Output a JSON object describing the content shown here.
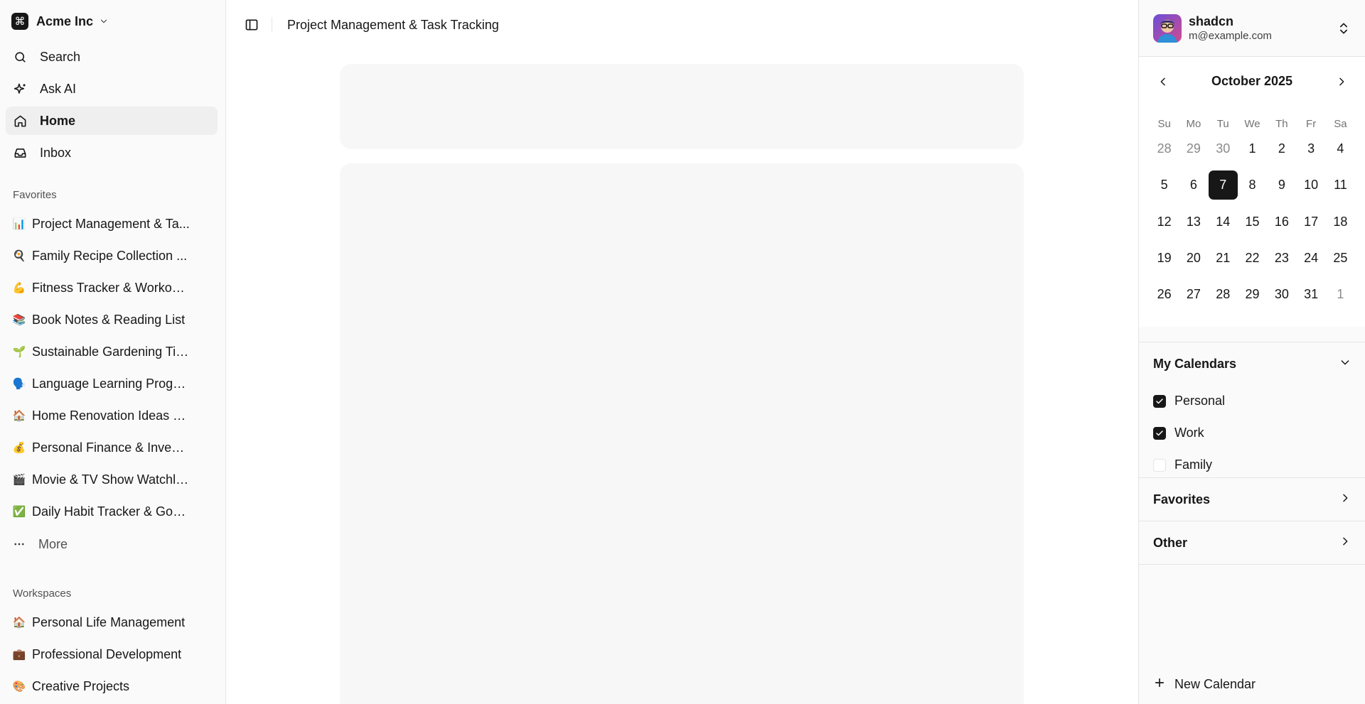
{
  "team": {
    "name": "Acme Inc",
    "logo_icon": "command-icon"
  },
  "nav": [
    {
      "label": "Search",
      "icon": "search-icon",
      "active": false
    },
    {
      "label": "Ask AI",
      "icon": "sparkles-icon",
      "active": false
    },
    {
      "label": "Home",
      "icon": "home-icon",
      "active": true
    },
    {
      "label": "Inbox",
      "icon": "inbox-icon",
      "active": false
    }
  ],
  "favorites": {
    "label": "Favorites",
    "items": [
      {
        "emoji": "📊",
        "label": "Project Management & Ta..."
      },
      {
        "emoji": "🍳",
        "label": "Family Recipe Collection ..."
      },
      {
        "emoji": "💪",
        "label": "Fitness Tracker & Workout..."
      },
      {
        "emoji": "📚",
        "label": "Book Notes & Reading List"
      },
      {
        "emoji": "🌱",
        "label": "Sustainable Gardening Tip..."
      },
      {
        "emoji": "🗣️",
        "label": "Language Learning Progre..."
      },
      {
        "emoji": "🏠",
        "label": "Home Renovation Ideas & ..."
      },
      {
        "emoji": "💰",
        "label": "Personal Finance & Invest..."
      },
      {
        "emoji": "🎬",
        "label": "Movie & TV Show Watchlis..."
      },
      {
        "emoji": "✅",
        "label": "Daily Habit Tracker & Goal ..."
      }
    ],
    "more_label": "More"
  },
  "workspaces": {
    "label": "Workspaces",
    "items": [
      {
        "emoji": "🏠",
        "label": "Personal Life Management"
      },
      {
        "emoji": "💼",
        "label": "Professional Development"
      },
      {
        "emoji": "🎨",
        "label": "Creative Projects"
      }
    ]
  },
  "header": {
    "title": "Project Management & Task Tracking"
  },
  "user": {
    "name": "shadcn",
    "email": "m@example.com"
  },
  "calendar": {
    "month_label": "October 2025",
    "weekdays": [
      "Su",
      "Mo",
      "Tu",
      "We",
      "Th",
      "Fr",
      "Sa"
    ],
    "days": [
      {
        "n": "28",
        "muted": true
      },
      {
        "n": "29",
        "muted": true
      },
      {
        "n": "30",
        "muted": true
      },
      {
        "n": "1"
      },
      {
        "n": "2"
      },
      {
        "n": "3"
      },
      {
        "n": "4"
      },
      {
        "n": "5"
      },
      {
        "n": "6"
      },
      {
        "n": "7",
        "selected": true
      },
      {
        "n": "8"
      },
      {
        "n": "9"
      },
      {
        "n": "10"
      },
      {
        "n": "11"
      },
      {
        "n": "12"
      },
      {
        "n": "13"
      },
      {
        "n": "14"
      },
      {
        "n": "15"
      },
      {
        "n": "16"
      },
      {
        "n": "17"
      },
      {
        "n": "18"
      },
      {
        "n": "19"
      },
      {
        "n": "20"
      },
      {
        "n": "21"
      },
      {
        "n": "22"
      },
      {
        "n": "23"
      },
      {
        "n": "24"
      },
      {
        "n": "25"
      },
      {
        "n": "26"
      },
      {
        "n": "27"
      },
      {
        "n": "28"
      },
      {
        "n": "29"
      },
      {
        "n": "30"
      },
      {
        "n": "31"
      },
      {
        "n": "1",
        "muted": true
      }
    ]
  },
  "calendars_section": {
    "title": "My Calendars",
    "items": [
      {
        "label": "Personal",
        "checked": true
      },
      {
        "label": "Work",
        "checked": true
      },
      {
        "label": "Family",
        "checked": false
      }
    ]
  },
  "favorites_section": {
    "title": "Favorites"
  },
  "other_section": {
    "title": "Other"
  },
  "new_calendar": {
    "label": "New Calendar"
  },
  "colors": {
    "primary": "#171717",
    "sidebar_bg": "#fafafa",
    "border": "#e5e5e5",
    "skeleton": "#f7f7f7"
  }
}
